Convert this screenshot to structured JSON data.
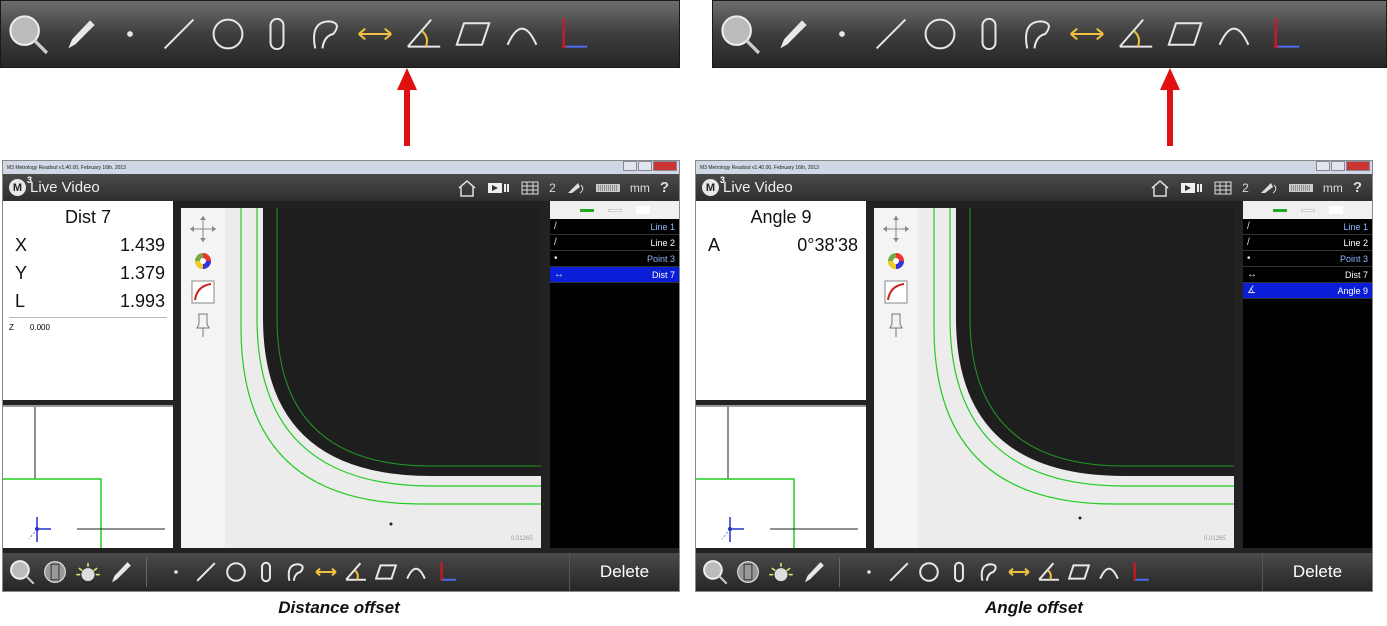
{
  "toolbars": {
    "icons": [
      "magnifier-icon",
      "pencil-icon",
      "point-icon",
      "line-icon",
      "circle-icon",
      "slot-icon",
      "arc-icon",
      "distance-icon",
      "angle-icon",
      "parallelogram-icon",
      "curve-icon",
      "skew-icon"
    ],
    "highlight_color": "#f0c040"
  },
  "arrow_color": "#e01010",
  "windows": [
    {
      "title": "M3 Metrology Readout  v1.40.00, February 16th, 2013",
      "header_title": "Live Video",
      "page_num": "2",
      "units": "mm",
      "help": "?",
      "readout": {
        "feature": "Dist 7",
        "rows": [
          {
            "axis": "X",
            "value": "1.439"
          },
          {
            "axis": "Y",
            "value": "1.379"
          },
          {
            "axis": "L",
            "value": "1.993"
          }
        ],
        "z_label": "Z",
        "z_value": "0.000"
      },
      "features": [
        {
          "icon": "/",
          "label": "Line 1",
          "style": "blue"
        },
        {
          "icon": "/",
          "label": "Line 2",
          "style": "white"
        },
        {
          "icon": "•",
          "label": "Point 3",
          "style": "blue"
        },
        {
          "icon": "↔",
          "label": "Dist 7",
          "style": "sel"
        }
      ],
      "delete_label": "Delete",
      "scale_text": "0.01265",
      "caption": "Distance offset"
    },
    {
      "title": "M3 Metrology Readout  v1.40.00, February 16th, 2013",
      "header_title": "Live Video",
      "page_num": "2",
      "units": "mm",
      "help": "?",
      "readout": {
        "feature": "Angle 9",
        "rows": [
          {
            "axis": "A",
            "value": "0°38'38"
          }
        ]
      },
      "features": [
        {
          "icon": "/",
          "label": "Line 1",
          "style": "blue"
        },
        {
          "icon": "/",
          "label": "Line 2",
          "style": "white"
        },
        {
          "icon": "•",
          "label": "Point 3",
          "style": "blue"
        },
        {
          "icon": "↔",
          "label": "Dist 7",
          "style": "white"
        },
        {
          "icon": "∡",
          "label": "Angle 9",
          "style": "sel"
        }
      ],
      "delete_label": "Delete",
      "scale_text": "0.01265",
      "caption": "Angle offset"
    }
  ]
}
